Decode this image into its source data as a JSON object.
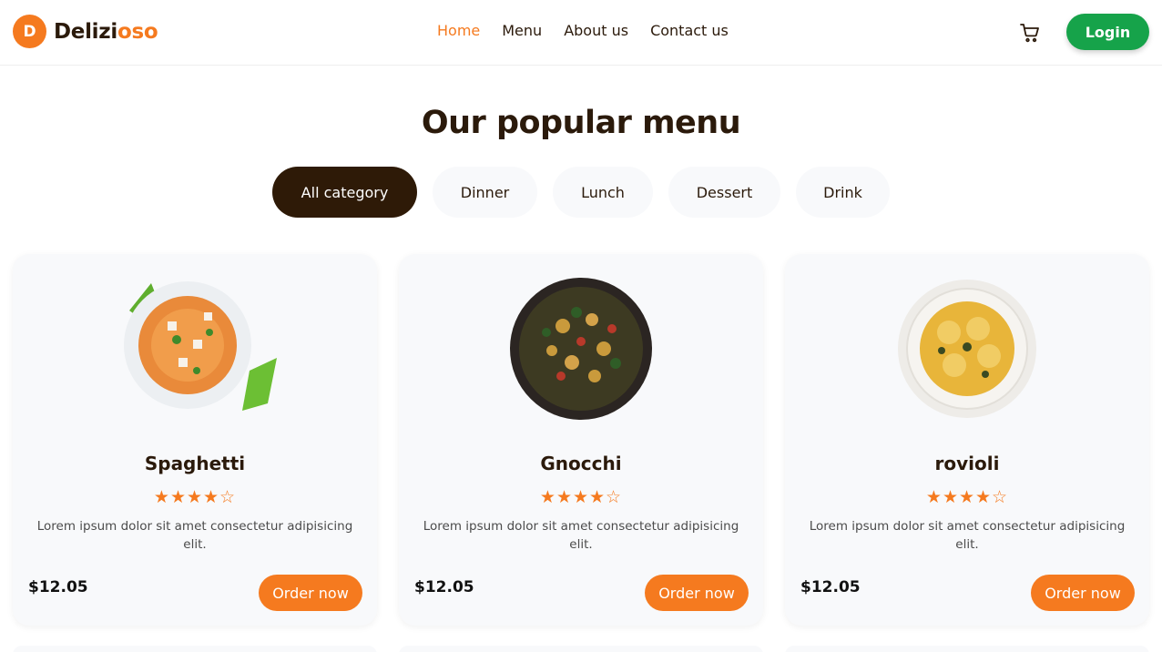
{
  "header": {
    "logo_letter": "D",
    "logo_text_dark": "Delizi",
    "logo_text_orange": "oso",
    "nav": [
      "Home",
      "Menu",
      "About us",
      "Contact us"
    ],
    "active_nav": "Home",
    "cart_icon": "cart-icon",
    "login_label": "Login"
  },
  "section": {
    "title": "Our popular menu"
  },
  "categories": [
    "All category",
    "Dinner",
    "Lunch",
    "Dessert",
    "Drink"
  ],
  "active_category": "All category",
  "cards": [
    {
      "name": "Spaghetti",
      "rating": 4.5,
      "stars": "★★★★☆",
      "description": "Lorem ipsum dolor sit amet consectetur adipisicing elit.",
      "price": "$12.05",
      "button": "Order now"
    },
    {
      "name": "Gnocchi",
      "rating": 4.5,
      "stars": "★★★★☆",
      "description": "Lorem ipsum dolor sit amet consectetur adipisicing elit.",
      "price": "$12.05",
      "button": "Order now"
    },
    {
      "name": "rovioli",
      "rating": 4.5,
      "stars": "★★★★☆",
      "description": "Lorem ipsum dolor sit amet consectetur adipisicing elit.",
      "price": "$12.05",
      "button": "Order now"
    }
  ],
  "colors": {
    "accent": "#f57a1f",
    "dark": "#2e1a07",
    "login": "#16a34a"
  }
}
